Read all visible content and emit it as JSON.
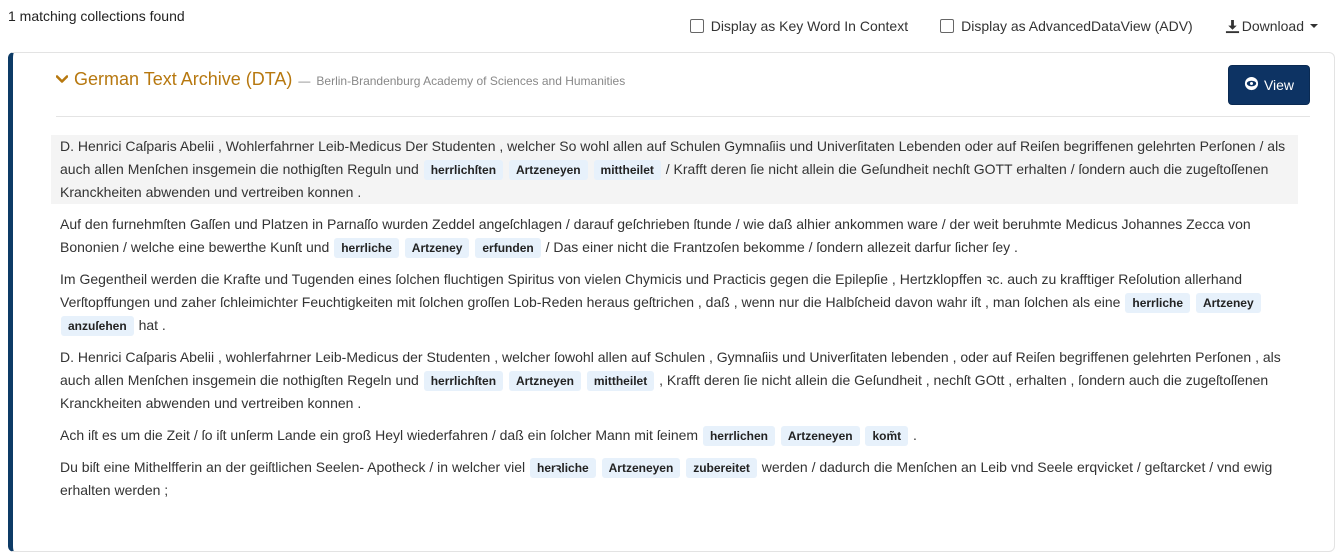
{
  "results": {
    "count_text": "1 matching collections found"
  },
  "toolbar": {
    "kwic_label": "Display as Key Word In Context",
    "kwic_checked": false,
    "adv_label": "Display as AdvancedDataView (ADV)",
    "adv_checked": false,
    "download_label": "Download",
    "download_icon": "download-icon"
  },
  "collection": {
    "title": "German Text Archive (DTA)",
    "separator": "—",
    "institution": "Berlin-Brandenburg Academy of Sciences and Humanities",
    "view_label": "View",
    "view_icon": "eye-icon",
    "expand_icon": "chevron-down-icon",
    "colors": {
      "accent": "#b7780f",
      "primary": "#0d3363",
      "highlight": "#e7f1fb"
    }
  },
  "hits": [
    {
      "shaded": true,
      "parts": [
        {
          "t": "D. Henrici Caſparis Abelii , Wohlerfahrner Leib-Medicus Der Studenten , welcher So wohl allen auf Schulen Gymnaſiis und Univerſitaten Lebenden oder auf Reiſen begriffenen gelehrten Perſonen / als auch allen Menſchen insgemein die nothigſten Reguln und "
        },
        {
          "k": "herrlichſten"
        },
        {
          "k": "Artzeneyen"
        },
        {
          "k": "mittheilet"
        },
        {
          "t": " / Krafft deren ſie nicht allein die Geſundheit nechſt GOTT erhalten / ſondern auch die zugeſtoſſenen Kranckheiten abwenden und vertreiben konnen ."
        }
      ]
    },
    {
      "shaded": false,
      "parts": [
        {
          "t": "Auf den furnehmſten Gaſſen und Platzen in Parnaſſo wurden Zeddel angeſchlagen / darauf geſchrieben ſtunde / wie daß alhier ankommen ware / der weit beruhmte Medicus Johannes Zecca von Bononien / welche eine bewerthe Kunſt und "
        },
        {
          "k": "herrliche"
        },
        {
          "k": "Artzeney"
        },
        {
          "k": "erfunden"
        },
        {
          "t": " / Das einer nicht die Frantzoſen bekomme / ſondern allezeit darfur ſicher ſey ."
        }
      ]
    },
    {
      "shaded": false,
      "parts": [
        {
          "t": "Im Gegentheil werden die Krafte und Tugenden eines ſolchen fluchtigen Spiritus von vielen Chymicis und Practicis gegen die Epilepſie , Hertzklopffen ꝛc. auch zu krafftiger Reſolution allerhand Verſtopffungen und zaher ſchleimichter Feuchtigkeiten mit ſolchen groſſen Lob-Reden heraus geſtrichen , daß , wenn nur die Halbſcheid davon wahr iſt , man ſolchen als eine "
        },
        {
          "k": "herrliche"
        },
        {
          "k": "Artzeney"
        },
        {
          "k": "anzuſehen"
        },
        {
          "t": " hat ."
        }
      ]
    },
    {
      "shaded": false,
      "parts": [
        {
          "t": "D. Henrici Caſparis Abelii , wohlerfahrner Leib-Medicus der Studenten , welcher ſowohl allen auf Schulen , Gymnaſiis und Univerſitaten lebenden , oder auf Reiſen begriffenen gelehrten Perſonen , als auch allen Menſchen insgemein die nothigſten Regeln und "
        },
        {
          "k": "herrlichſten"
        },
        {
          "k": "Artzneyen"
        },
        {
          "k": "mittheilet"
        },
        {
          "t": " , Krafft deren ſie nicht allein die Geſundheit , nechſt GOtt , erhalten , ſondern auch die zugeſtoſſenen Kranckheiten abwenden und vertreiben konnen ."
        }
      ]
    },
    {
      "shaded": false,
      "parts": [
        {
          "t": "Ach iſt es um die Zeit / ſo iſt unſerm Lande ein groß Heyl wiederfahren / daß ein ſolcher Mann mit ſeinem "
        },
        {
          "k": "herrlichen"
        },
        {
          "k": "Artzeneyen"
        },
        {
          "k": "kom̃t"
        },
        {
          "t": " ."
        }
      ]
    },
    {
      "shaded": false,
      "parts": [
        {
          "t": "Du biſt eine Mithelfferin an der geiſtlichen Seelen- Apotheck / in welcher viel "
        },
        {
          "k": "herꝛliche"
        },
        {
          "k": "Artzeneyen"
        },
        {
          "k": "zubereitet"
        },
        {
          "t": " werden / dadurch die Menſchen an Leib vnd Seele erqvicket / geſtarcket / vnd ewig erhalten werden ;"
        }
      ]
    }
  ]
}
